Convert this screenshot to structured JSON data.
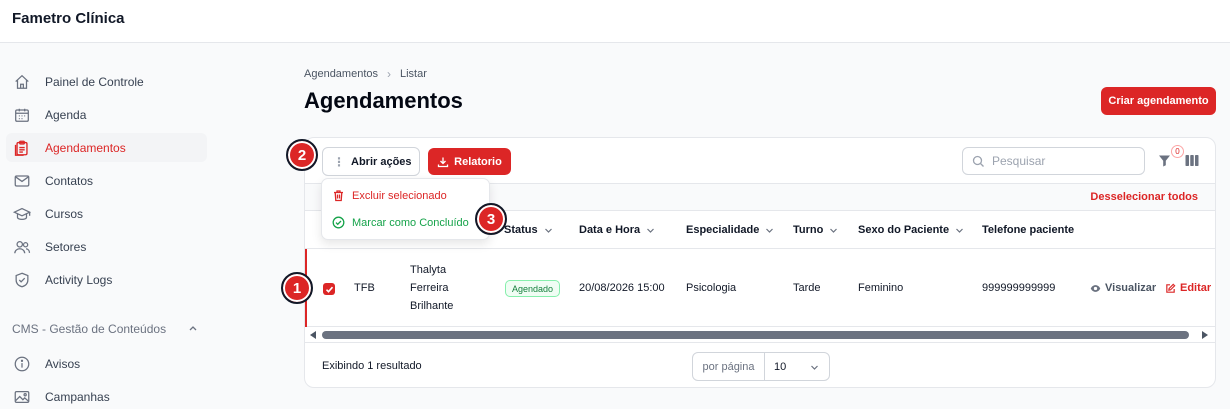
{
  "app": {
    "brand": "Fametro Clínica"
  },
  "sidebar": {
    "items": [
      {
        "label": "Painel de Controle",
        "icon": "home-icon"
      },
      {
        "label": "Agenda",
        "icon": "calendar-icon"
      },
      {
        "label": "Agendamentos",
        "icon": "clipboard-icon",
        "active": true
      },
      {
        "label": "Contatos",
        "icon": "envelope-icon"
      },
      {
        "label": "Cursos",
        "icon": "graduation-cap-icon"
      },
      {
        "label": "Setores",
        "icon": "users-icon"
      },
      {
        "label": "Activity Logs",
        "icon": "shield-check-icon"
      }
    ],
    "group": {
      "label": "CMS - Gestão de Conteúdos",
      "items": [
        {
          "label": "Avisos",
          "icon": "info-circle-icon"
        },
        {
          "label": "Campanhas",
          "icon": "photo-icon"
        }
      ]
    }
  },
  "breadcrumb": {
    "parent": "Agendamentos",
    "current": "Listar"
  },
  "page": {
    "title": "Agendamentos",
    "create_label": "Criar agendamento"
  },
  "toolbar": {
    "actions_label": "Abrir ações",
    "report_label": "Relatorio",
    "search_placeholder": "Pesquisar",
    "filter_count": "0"
  },
  "selection": {
    "deselect_label": "Desselecionar todos"
  },
  "bulk_menu": {
    "delete_label": "Excluir selecionado",
    "done_label": "Marcar como Concluído"
  },
  "table": {
    "columns": [
      "Status",
      "Data e Hora",
      "Especialidade",
      "Turno",
      "Sexo do Paciente",
      "Telefone paciente"
    ],
    "rows": [
      {
        "code": "TFB",
        "name_lines": [
          "Thalyta",
          "Ferreira",
          "Brilhante"
        ],
        "status": "Agendado",
        "datetime": "20/08/2026 15:00",
        "specialty": "Psicologia",
        "shift": "Tarde",
        "sex": "Feminino",
        "phone": "999999999999",
        "view_label": "Visualizar",
        "edit_label": "Editar",
        "selected": true
      }
    ]
  },
  "footer": {
    "results_text": "Exibindo 1 resultado",
    "per_page_label": "por página",
    "per_page_value": "10"
  },
  "annotations": [
    "1",
    "2",
    "3"
  ],
  "colors": {
    "accent": "#dc2626",
    "success": "#16a34a",
    "text": "#111827",
    "muted": "#6b7280"
  }
}
